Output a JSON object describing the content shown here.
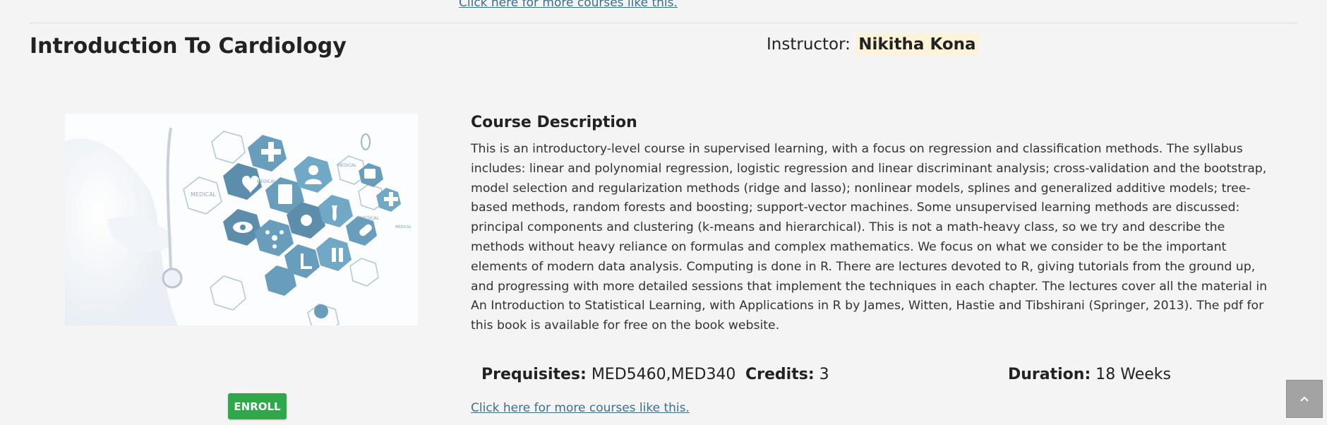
{
  "links": {
    "top": "Click here for more courses like this.",
    "bottom": "Click here for more courses like this."
  },
  "course": {
    "title": "Introduction To Cardiology",
    "instructor_label": "Instructor:",
    "instructor_name": "Nikitha Kona"
  },
  "image": {
    "labels": [
      "MEDICAL",
      "MEDICAL",
      "MEDICAL",
      "MEDICAL",
      "MEDICAL"
    ]
  },
  "enroll_label": "ENROLL",
  "description": {
    "heading": "Course Description",
    "text": "This is an introductory-level course in supervised learning, with a focus on regression and classification methods. The syllabus includes: linear and polynomial regression, logistic regression and linear discriminant analysis; cross-validation and the bootstrap, model selection and regularization methods (ridge and lasso); nonlinear models, splines and generalized additive models; tree-based methods, random forests and boosting; support-vector machines. Some unsupervised learning methods are discussed: principal components and clustering (k-means and hierarchical). This is not a math-heavy class, so we try and describe the methods without heavy reliance on formulas and complex mathematics. We focus on what we consider to be the important elements of modern data analysis. Computing is done in R. There are lectures devoted to R, giving tutorials from the ground up, and progressing with more detailed sessions that implement the techniques in each chapter. The lectures cover all the material in An Introduction to Statistical Learning, with Applications in R by James, Witten, Hastie and Tibshirani (Springer, 2013). The pdf for this book is available for free on the book website."
  },
  "stats": {
    "prereq_label": "Prequisites:",
    "prereq_value": "MED5460,MED340",
    "credits_label": "Credits:",
    "credits_value": "3",
    "duration_label": "Duration:",
    "duration_value": "18 Weeks"
  },
  "scroll_top_icon": "chevron-up-icon",
  "colors": {
    "background": "#f4f4f4",
    "link": "#3b6f8f",
    "enroll": "#2ea84a",
    "instructor_highlight": "#fdf3d8",
    "hex_primary": "#3e83a8"
  }
}
